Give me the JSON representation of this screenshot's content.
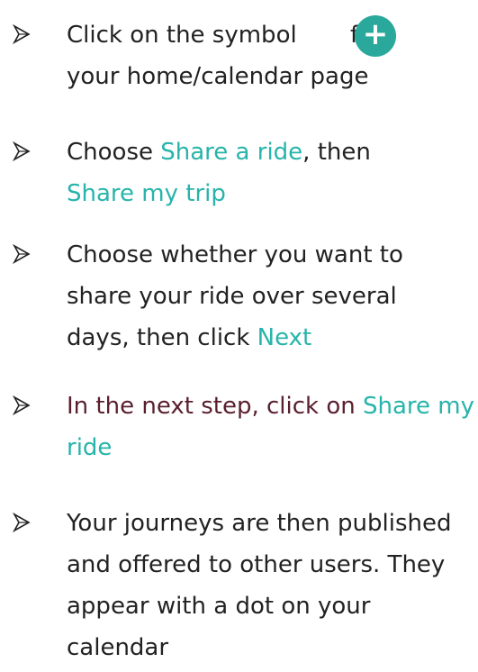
{
  "colors": {
    "accent": "#27b4aa",
    "text": "#222222",
    "maroon_text": "#5a1f2f",
    "plus_button": "#2aa89c"
  },
  "bullet_icon": "arrow-bullet-icon",
  "steps": [
    {
      "line1_prefix": "Click on the symbol",
      "overlap_fragment": "fr",
      "plus_symbol": "+",
      "overlap_tail": "",
      "line2": "your home/calendar page"
    },
    {
      "prefix": "Choose ",
      "link1": "Share a ride",
      "middle": ", then",
      "link2": "Share my trip"
    },
    {
      "text": "Choose whether you want to share your ride over several days, then click ",
      "link": "Next"
    },
    {
      "text": "In the next step, click on ",
      "link": "Share my ride"
    },
    {
      "text": "Your journeys are then published and offered to other users. They appear with a dot on your calendar"
    }
  ]
}
